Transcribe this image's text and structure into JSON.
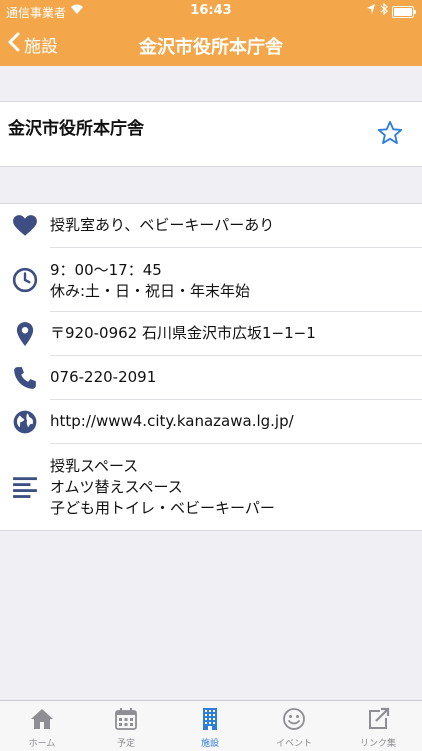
{
  "status_bar": {
    "carrier": "通信事業者",
    "time": "16:43"
  },
  "nav": {
    "back_label": "施設",
    "title": "金沢市役所本庁舎"
  },
  "facility": {
    "name": "金沢市役所本庁舎"
  },
  "details": {
    "amenities": "授乳室あり、ベビーキーパーあり",
    "hours_line1": "9：00〜17：45",
    "hours_line2": "休み:土・日・祝日・年末年始",
    "address": "〒920-0962 石川県金沢市広坂1−1−1",
    "phone": "076-220-2091",
    "url": "http://www4.city.kanazawa.lg.jp/",
    "facilities_line1": "授乳スペース",
    "facilities_line2": "オムツ替えスペース",
    "facilities_line3": "子ども用トイレ・ベビーキーパー"
  },
  "tabs": [
    {
      "label": "ホーム",
      "icon": "home-icon"
    },
    {
      "label": "予定",
      "icon": "calendar-icon"
    },
    {
      "label": "施設",
      "icon": "building-icon"
    },
    {
      "label": "イベント",
      "icon": "smiley-icon"
    },
    {
      "label": "リンク集",
      "icon": "external-link-icon"
    }
  ],
  "colors": {
    "accent": "#f3a64a",
    "icon": "#3d4f82",
    "active_tab": "#2f7ed8",
    "star": "#2f7ed8"
  }
}
